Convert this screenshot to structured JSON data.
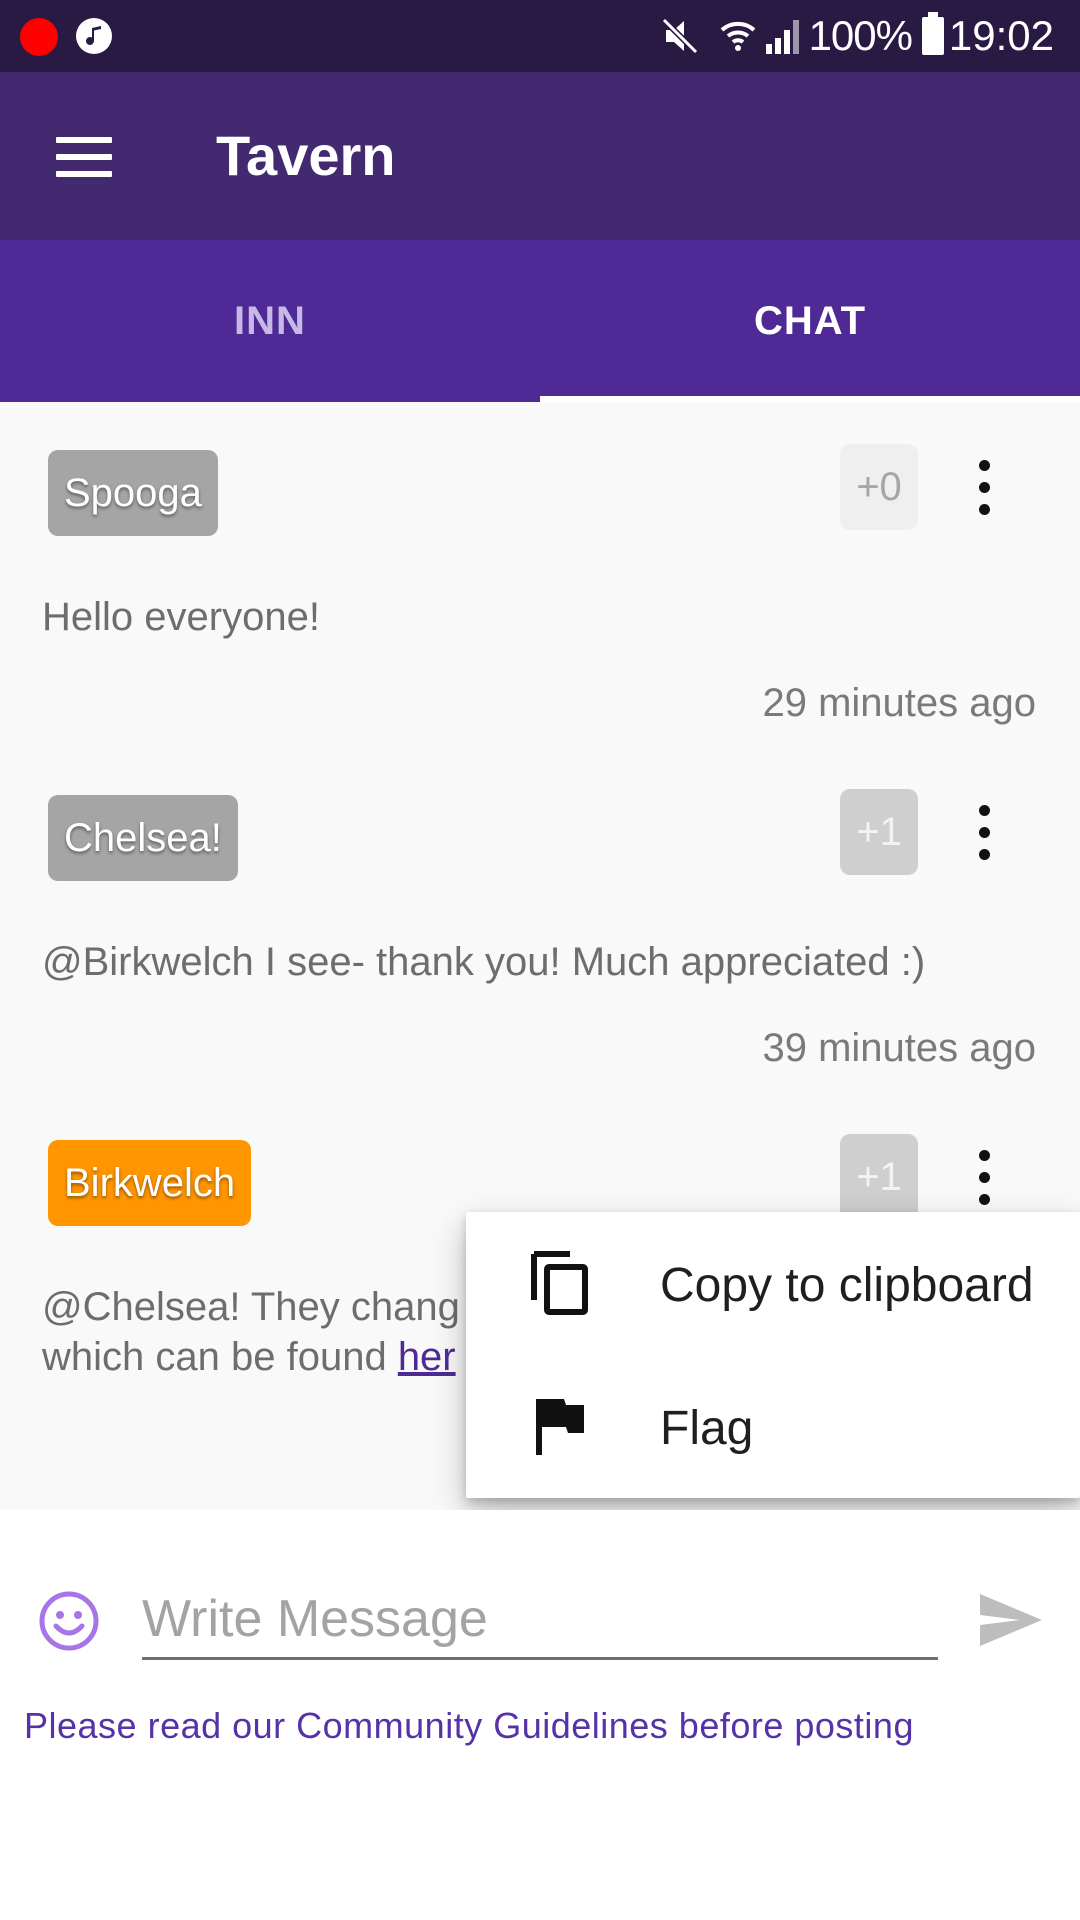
{
  "status_bar": {
    "battery": "100%",
    "time": "19:02"
  },
  "app_bar": {
    "title": "Tavern"
  },
  "tabs": [
    {
      "label": "INN",
      "selected": false
    },
    {
      "label": "CHAT",
      "selected": true
    }
  ],
  "messages": [
    {
      "user": "Spooga",
      "text": "Hello everyone!",
      "likes": "+0",
      "time": "29 minutes ago"
    },
    {
      "user": "Chelsea!",
      "text": "@Birkwelch I see- thank you! Much appreciated :)",
      "likes": "+1",
      "time": "39 minutes ago"
    },
    {
      "user": "Birkwelch",
      "text_line1": "@Chelsea! They chang",
      "text_line2": "which can be found ",
      "link_text": "her",
      "likes": "+1"
    }
  ],
  "popup_menu": {
    "items": [
      {
        "label": "Copy to clipboard",
        "icon": "copy-icon"
      },
      {
        "label": "Flag",
        "icon": "flag-icon"
      }
    ]
  },
  "composer": {
    "placeholder": "Write Message",
    "guidelines": "Please read our Community Guidelines before posting"
  },
  "colors": {
    "status_bar": "#281a43",
    "app_bar": "#43296f",
    "tab_bar": "#4f2a96",
    "accent": "#5631a8",
    "chip_gray": "#a5a5a5",
    "chip_orange": "#ff9500"
  }
}
